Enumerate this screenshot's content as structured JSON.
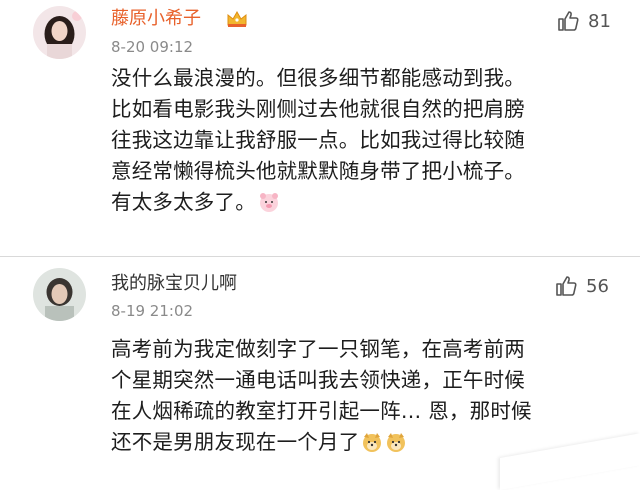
{
  "comments": [
    {
      "username": "藤原小希子",
      "time": "8-20 09:12",
      "likes": "81",
      "vip_badge": "crown-icon",
      "lines": [
        "没什么最浪漫的。但很多细节都能感动到我。",
        "比如看电影我头刚侧过去他就很自然的把肩膀",
        "往我这边靠让我舒服一点。比如我过得比较随",
        "意经常懒得梳头他就默默随身带了把小梳子。",
        "有太多太多了。"
      ],
      "trailing_emoji": [
        "pig-emoji"
      ]
    },
    {
      "username": "我的脉宝贝儿啊",
      "time": "8-19 21:02",
      "likes": "56",
      "lines": [
        "高考前为我定做刻字了一只钢笔，在高考前两",
        "个星期突然一通电话叫我去领快递，正午时候",
        "在人烟稀疏的教室打开引起一阵…  恩，那时候",
        "还不是男朋友现在一个月了"
      ],
      "trailing_emoji": [
        "doge-emoji",
        "doge-emoji"
      ]
    }
  ],
  "colors": {
    "vip_name": "#e8612b",
    "normal_name": "#333333",
    "time": "#8a8a8a",
    "body": "#1d1d1d",
    "divider": "#d9d9d9"
  }
}
